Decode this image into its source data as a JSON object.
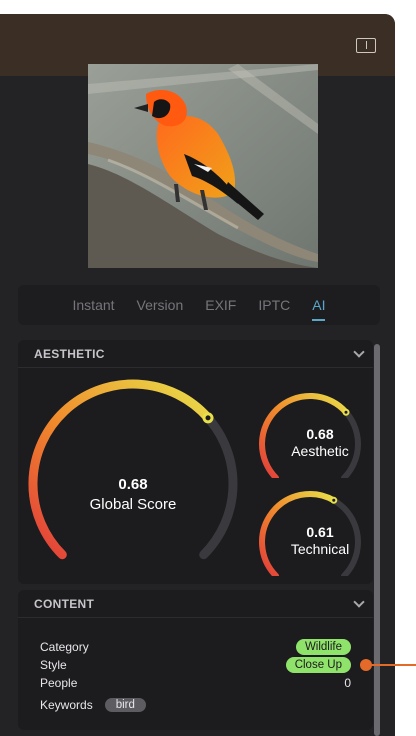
{
  "window": {
    "sidebar_toggle_icon": "sidebar-toggle-icon"
  },
  "photo": {
    "subject": "bird"
  },
  "tabs": [
    {
      "label": "Instant",
      "active": false
    },
    {
      "label": "Version",
      "active": false
    },
    {
      "label": "EXIF",
      "active": false
    },
    {
      "label": "IPTC",
      "active": false
    },
    {
      "label": "AI",
      "active": true
    }
  ],
  "aesthetic": {
    "title": "AESTHETIC",
    "global": {
      "value": "0.68",
      "label": "Global Score",
      "fraction": 0.68
    },
    "aesthetic": {
      "value": "0.68",
      "label": "Aesthetic",
      "fraction": 0.68
    },
    "technical": {
      "value": "0.61",
      "label": "Technical",
      "fraction": 0.61
    }
  },
  "content": {
    "title": "CONTENT",
    "category_label": "Category",
    "category_value": "Wildlife",
    "style_label": "Style",
    "style_value": "Close Up",
    "people_label": "People",
    "people_value": "0",
    "keywords_label": "Keywords",
    "keywords": [
      "bird"
    ]
  },
  "colors": {
    "panel": "#232225",
    "titlebar": "#3b2e25",
    "accent": "#5aa7c9",
    "tag_green": "#8fe36b",
    "gauge_start": "#e23b3b",
    "gauge_end": "#e8e04a",
    "callout": "#e46a2a"
  }
}
